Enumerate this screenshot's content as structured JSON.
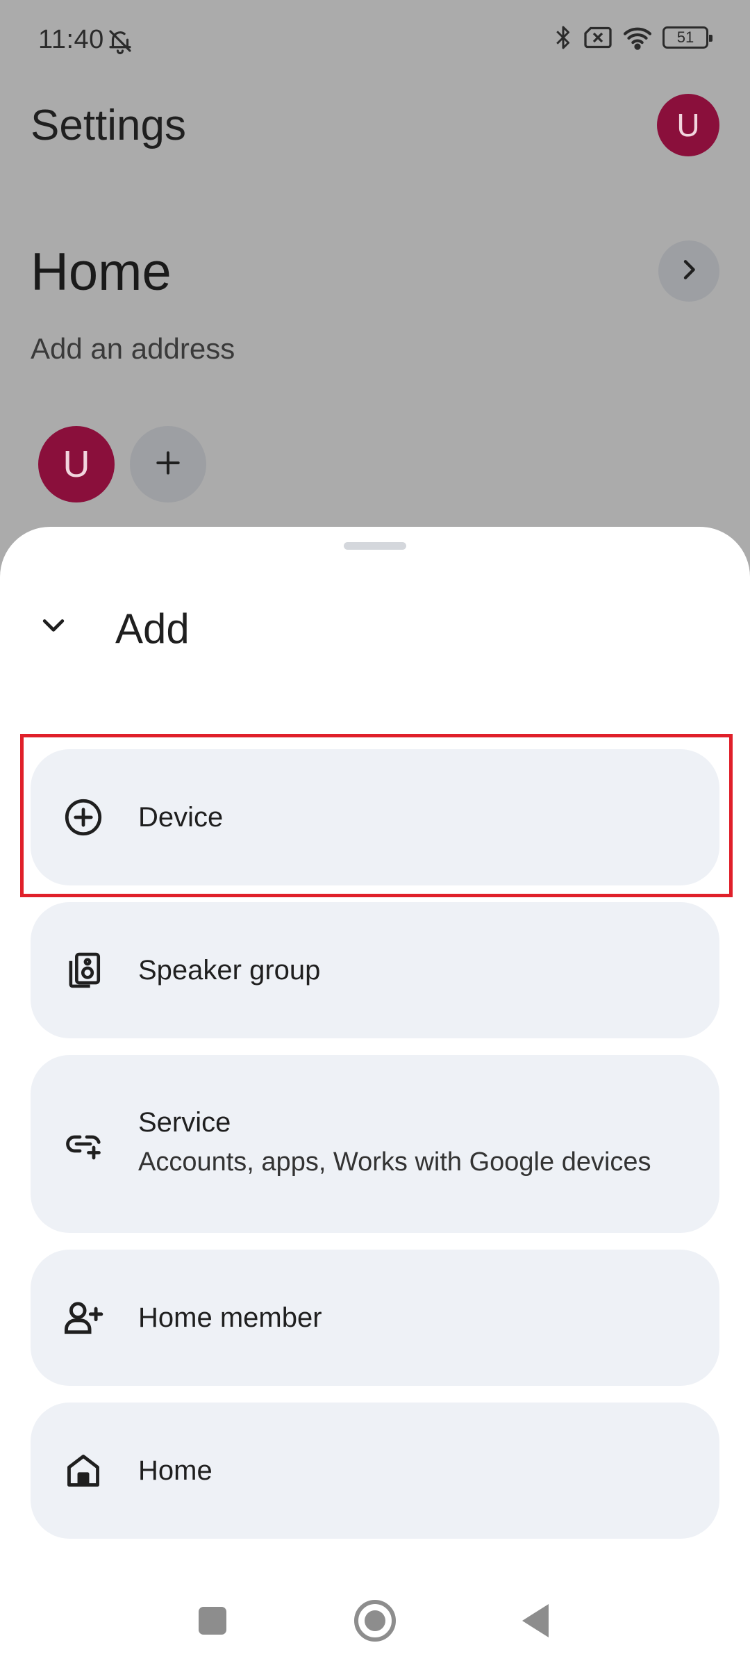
{
  "status_bar": {
    "time": "11:40",
    "battery": "51"
  },
  "background": {
    "page_title": "Settings",
    "profile_initial": "U",
    "home_title": "Home",
    "home_address": "Add an address",
    "member_initial": "U"
  },
  "sheet": {
    "title": "Add",
    "options": [
      {
        "label": "Device",
        "icon": "add-circle-icon"
      },
      {
        "label": "Speaker group",
        "icon": "speaker-group-icon"
      },
      {
        "label": "Service",
        "subtitle": "Accounts, apps, Works with Google devices",
        "icon": "link-add-icon"
      },
      {
        "label": "Home member",
        "icon": "person-add-icon"
      },
      {
        "label": "Home",
        "icon": "home-icon"
      }
    ]
  },
  "colors": {
    "scrim_background": "#ababab",
    "avatar": "#8a0f3b",
    "option_background": "#eef1f6",
    "highlight": "#e0202a"
  }
}
